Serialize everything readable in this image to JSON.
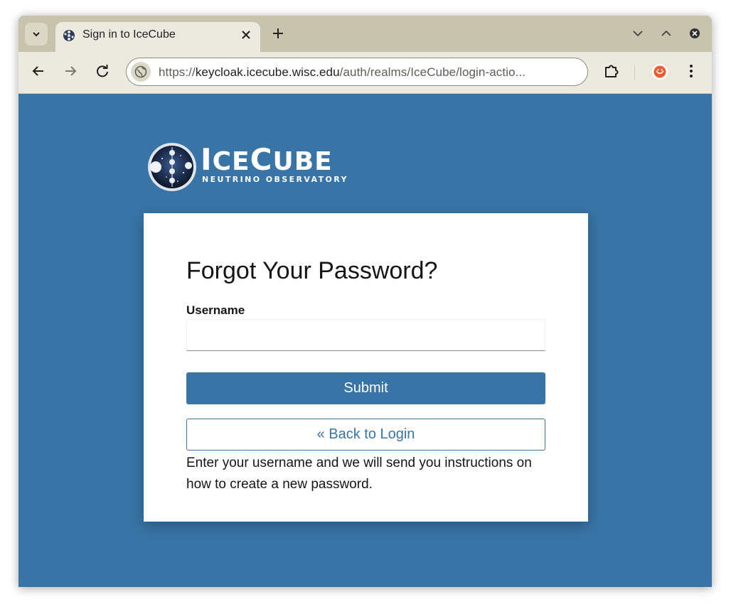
{
  "browser": {
    "tab": {
      "title": "Sign in to IceCube"
    },
    "address_bar": {
      "scheme": "https://",
      "host": "keycloak.icecube.wisc.edu",
      "path": "/auth/realms/IceCube/login-actio..."
    },
    "icons": {
      "tab_search": "chevron-down-icon",
      "tab_close": "close-icon",
      "new_tab": "plus-icon",
      "minimize": "chevron-down-icon",
      "maximize": "chevron-up-icon",
      "window_close": "close-circle-icon",
      "back": "arrow-left-icon",
      "forward": "arrow-right-icon",
      "reload": "reload-icon",
      "site_info": "globe-icon",
      "extensions": "puzzle-icon",
      "profile": "avatar-icon",
      "menu": "kebab-menu-icon"
    }
  },
  "logo": {
    "word_lead1": "I",
    "word_rest1": "CE",
    "word_lead2": "C",
    "word_rest2": "UBE",
    "subtitle": "Neutrino Observatory"
  },
  "form": {
    "title": "Forgot Your Password?",
    "username_label": "Username",
    "username_value": "",
    "submit_label": "Submit",
    "back_label": "« Back to Login",
    "info_text": "Enter your username and we will send you instructions on how to create a new password."
  },
  "colors": {
    "page_bg": "#3874a6",
    "primary": "#3874a6",
    "chrome_frame": "#c8c3ad",
    "chrome_toolbar": "#ece9df"
  }
}
